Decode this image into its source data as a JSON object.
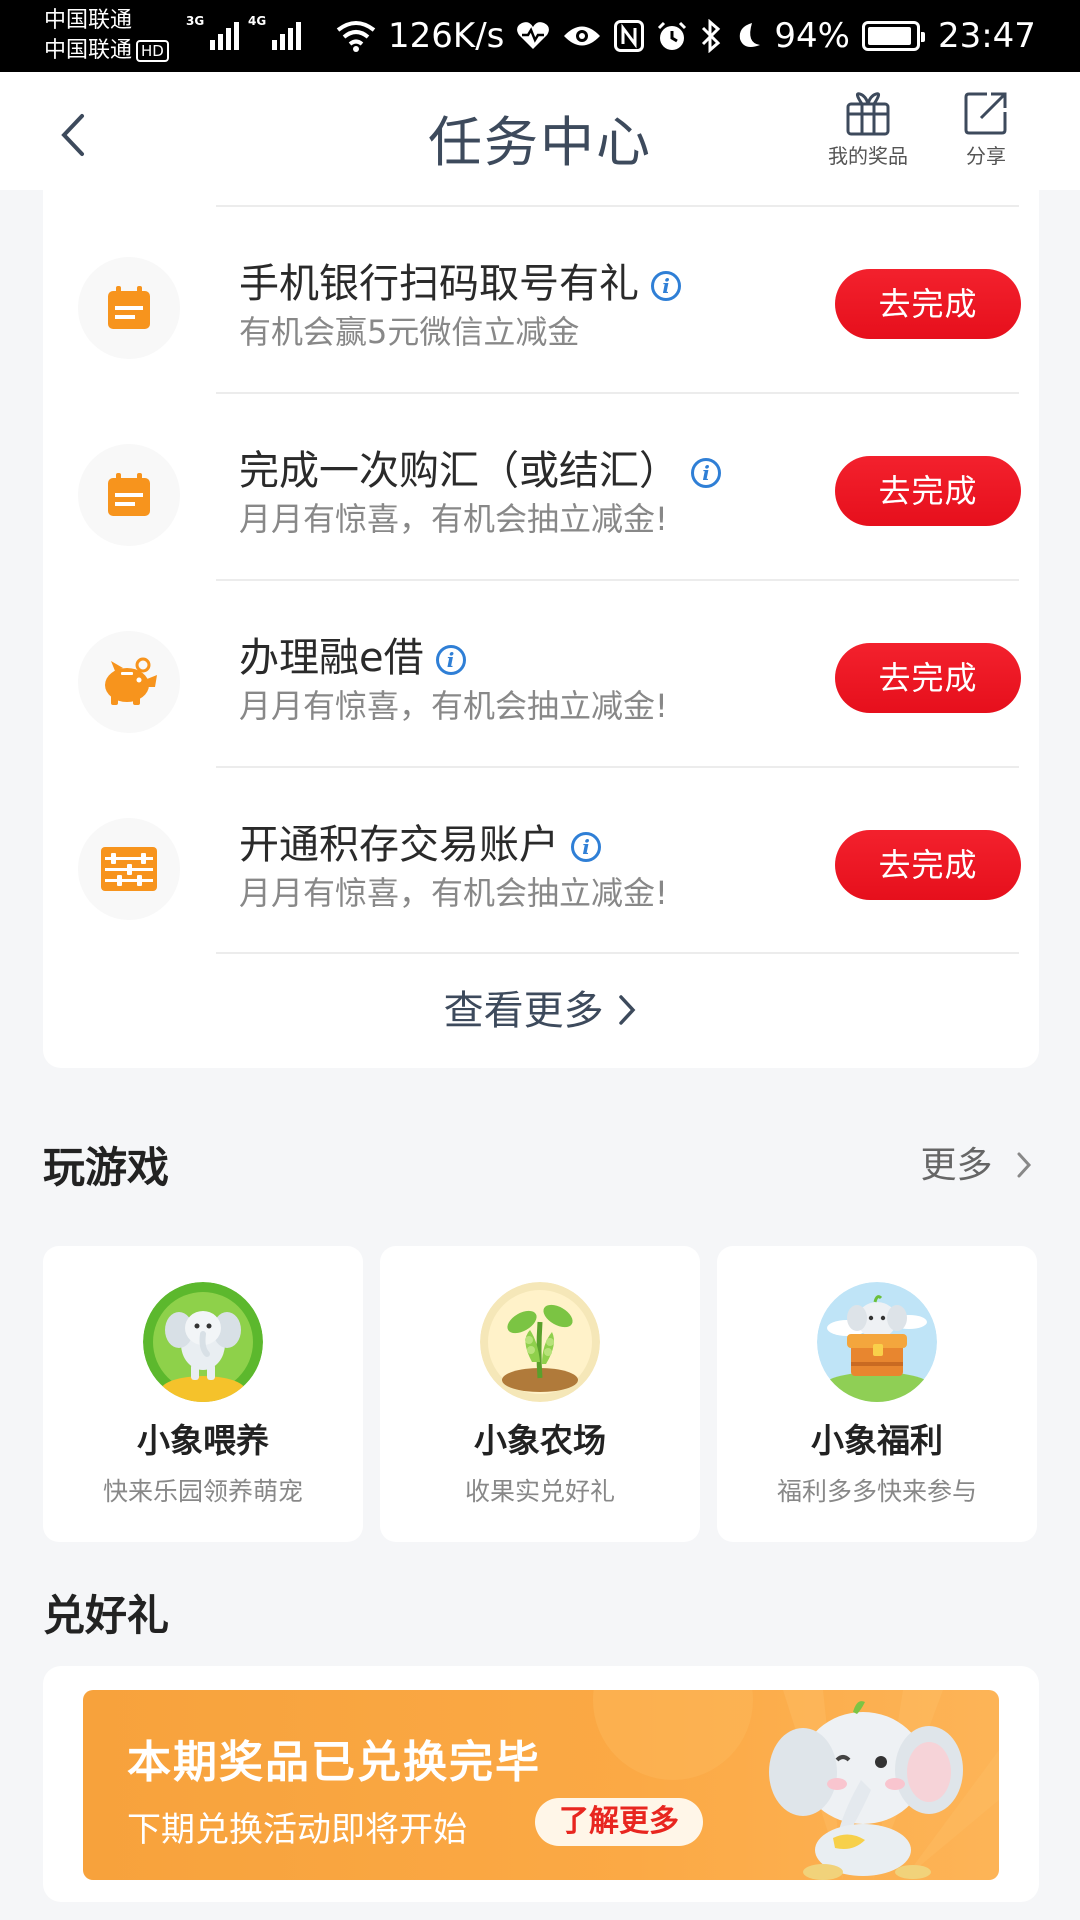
{
  "status_bar": {
    "carrier1": "中国联通",
    "carrier2": "中国联通",
    "hd": "HD",
    "net1": "3G",
    "net2": "4G",
    "speed": "126K/s",
    "battery": "94%",
    "battery_level": 0.94,
    "time": "23:47"
  },
  "header": {
    "title": "任务中心",
    "prizes_label": "我的奖品",
    "share_label": "分享"
  },
  "tasks": [
    {
      "name": "手机银行扫码取号有礼",
      "desc": "有机会赢5元微信立减金",
      "button": "去完成",
      "icon": "calendar-icon"
    },
    {
      "name": "完成一次购汇（或结汇）",
      "desc": "月月有惊喜，有机会抽立减金!",
      "button": "去完成",
      "icon": "calendar-icon"
    },
    {
      "name": "办理融e借",
      "desc": "月月有惊喜，有机会抽立减金!",
      "button": "去完成",
      "icon": "piggy-bank-icon"
    },
    {
      "name": "开通积存交易账户",
      "desc": "月月有惊喜，有机会抽立减金!",
      "button": "去完成",
      "icon": "abacus-icon"
    }
  ],
  "view_more": "查看更多",
  "games": {
    "title": "玩游戏",
    "more": "更多",
    "items": [
      {
        "name": "小象喂养",
        "desc": "快来乐园领养萌宠"
      },
      {
        "name": "小象农场",
        "desc": "收果实兑好礼"
      },
      {
        "name": "小象福利",
        "desc": "福利多多快来参与"
      }
    ]
  },
  "rewards": {
    "title": "兑好礼",
    "banner_title": "本期奖品已兑换完毕",
    "banner_sub": "下期兑换活动即将开始",
    "banner_button": "了解更多"
  },
  "colors": {
    "accent_red": "#e8141f",
    "icon_orange": "#f7941d",
    "info_blue": "#2f7fd6",
    "banner_orange": "#f9a53f"
  }
}
